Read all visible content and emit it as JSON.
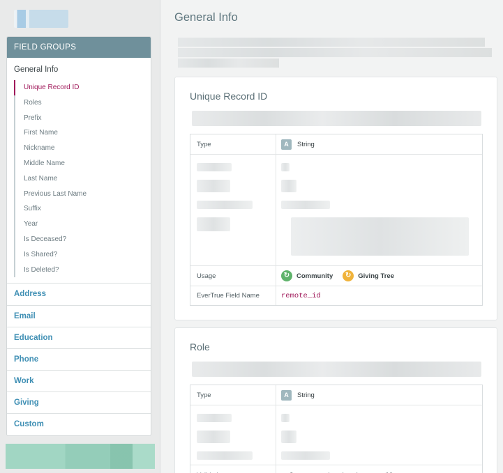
{
  "sidebar": {
    "header": "FIELD GROUPS",
    "active_group": "General Info",
    "sub_items": [
      "Unique Record ID",
      "Roles",
      "Prefix",
      "First Name",
      "Nickname",
      "Middle Name",
      "Last Name",
      "Previous Last Name",
      "Suffix",
      "Year",
      "Is Deceased?",
      "Is Shared?",
      "Is Deleted?"
    ],
    "groups": [
      "Address",
      "Email",
      "Education",
      "Phone",
      "Work",
      "Giving",
      "Custom"
    ]
  },
  "main": {
    "title": "General Info",
    "cards": [
      {
        "title": "Unique Record ID",
        "type_label": "Type",
        "type_badge": "A",
        "type_value": "String",
        "usage_label": "Usage",
        "usage": [
          {
            "name": "Community",
            "icon": "community-icon",
            "color": "#5fb36b"
          },
          {
            "name": "Giving Tree",
            "icon": "giving-tree-icon",
            "color": "#f0b33b"
          }
        ],
        "field_name_label": "EverTrue Field Name",
        "field_name": "remote_id"
      },
      {
        "title": "Role",
        "type_label": "Type",
        "type_badge": "A",
        "type_value": "String",
        "validation_label": "Validation",
        "validation_value": "Cannot contain colon characters \":\""
      }
    ]
  },
  "colors": {
    "accent": "#a0195a",
    "header": "#6f909b",
    "link": "#3f8fb4"
  }
}
